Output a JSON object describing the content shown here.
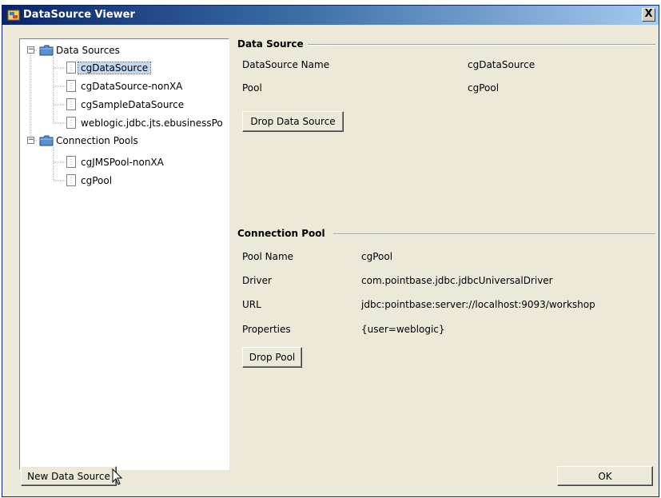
{
  "window": {
    "title": "DataSource Viewer",
    "close_label": "X"
  },
  "tree": {
    "groups": [
      {
        "label": "Data Sources",
        "expander": "−",
        "items": [
          "cgDataSource",
          "cgDataSource-nonXA",
          "cgSampleDataSource",
          "weblogic.jdbc.jts.ebusinessPo"
        ]
      },
      {
        "label": "Connection Pools",
        "expander": "−",
        "items": [
          "cgJMSPool-nonXA",
          "cgPool"
        ]
      }
    ],
    "selected": "cgDataSource"
  },
  "data_source": {
    "header": "Data Source",
    "name_label": "DataSource Name",
    "name_value": "cgDataSource",
    "pool_label": "Pool",
    "pool_value": "cgPool",
    "drop_button": "Drop Data Source"
  },
  "connection_pool": {
    "header": "Connection Pool",
    "fields": [
      {
        "label": "Pool Name",
        "value": "cgPool"
      },
      {
        "label": "Driver",
        "value": "com.pointbase.jdbc.jdbcUniversalDriver"
      },
      {
        "label": "URL",
        "value": "jdbc:pointbase:server://localhost:9093/workshop"
      },
      {
        "label": "Properties",
        "value": "{user=weblogic}"
      }
    ],
    "drop_button": "Drop Pool"
  },
  "footer": {
    "new_button": "New Data Source",
    "ok_button": "OK"
  },
  "colors": {
    "title_start": "#0a246a",
    "title_end": "#a6caf0",
    "face": "#ece9d8",
    "selection": "#c0d8f0"
  }
}
